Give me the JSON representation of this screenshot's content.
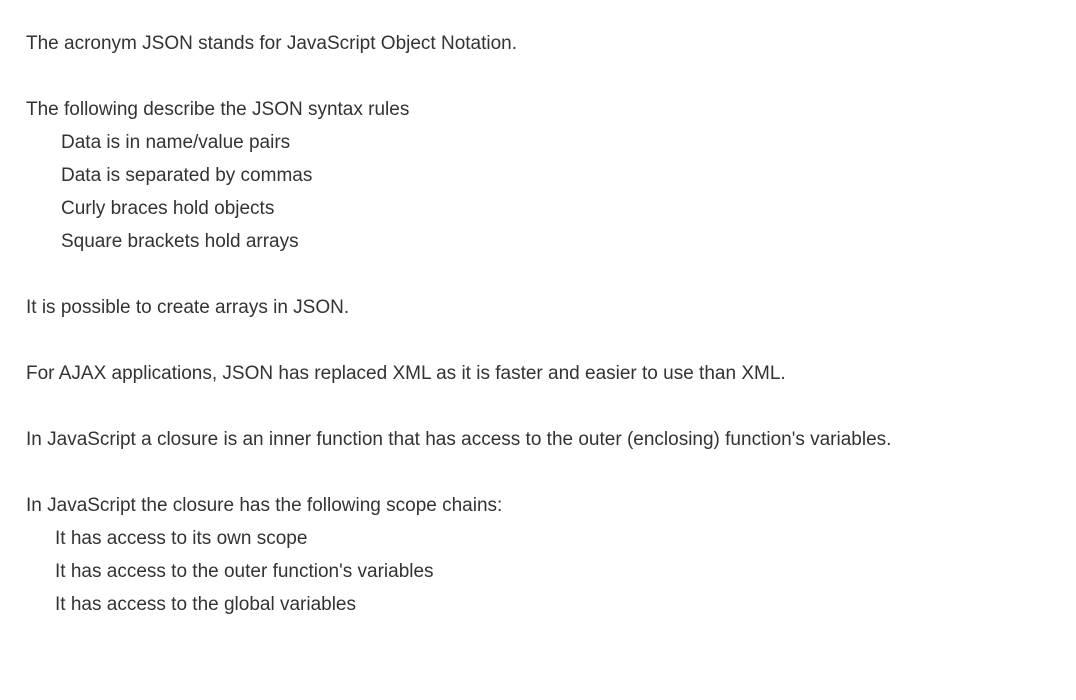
{
  "p1": "The acronym JSON stands for JavaScript Object Notation.",
  "p2": "The following describe the JSON syntax rules",
  "rules": [
    "Data is in name/value pairs",
    "Data is separated by commas",
    "Curly braces hold objects",
    "Square brackets hold arrays"
  ],
  "p3": "It is possible to create arrays in JSON.",
  "p4": "For AJAX applications, JSON has replaced XML as it is faster and easier to use than XML.",
  "p5": "In JavaScript a closure is an inner function that has access to the outer (enclosing) function's variables.",
  "p6": "In JavaScript the closure has the following scope chains:",
  "chains": [
    "It has access to its own scope",
    "It has access to the outer function's variables",
    "It has access to the global variables"
  ]
}
